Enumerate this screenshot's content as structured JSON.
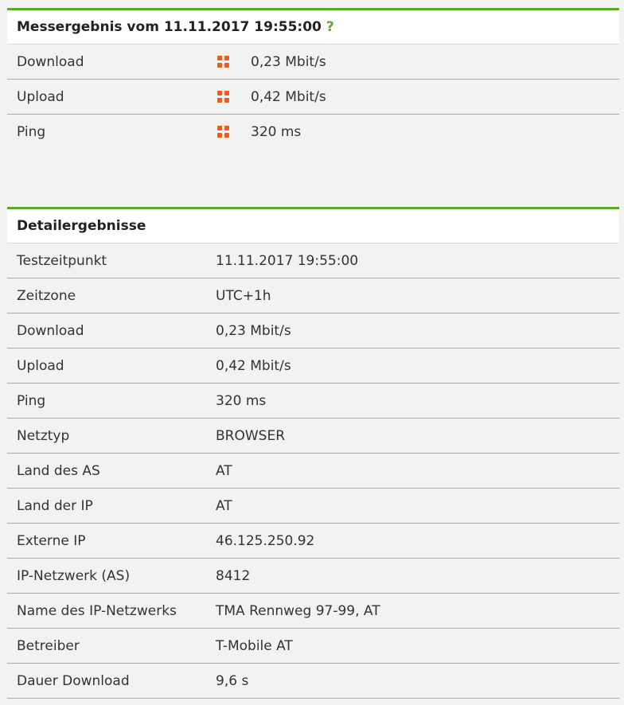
{
  "summary": {
    "title": "Messergebnis vom 11.11.2017 19:55:00",
    "help": "?",
    "rows": [
      {
        "label": "Download",
        "value": "0,23 Mbit/s",
        "quality": "poor"
      },
      {
        "label": "Upload",
        "value": "0,42 Mbit/s",
        "quality": "poor"
      },
      {
        "label": "Ping",
        "value": "320 ms",
        "quality": "poor"
      }
    ]
  },
  "details": {
    "title": "Detailergebnisse",
    "rows": [
      {
        "label": "Testzeitpunkt",
        "value": "11.11.2017 19:55:00"
      },
      {
        "label": "Zeitzone",
        "value": "UTC+1h"
      },
      {
        "label": "Download",
        "value": "0,23 Mbit/s"
      },
      {
        "label": "Upload",
        "value": "0,42 Mbit/s"
      },
      {
        "label": "Ping",
        "value": "320 ms"
      },
      {
        "label": "Netztyp",
        "value": "BROWSER"
      },
      {
        "label": "Land des AS",
        "value": "AT"
      },
      {
        "label": "Land der IP",
        "value": "AT"
      },
      {
        "label": "Externe IP",
        "value": "46.125.250.92"
      },
      {
        "label": "IP-Netzwerk (AS)",
        "value": "8412"
      },
      {
        "label": "Name des IP-Netzwerks",
        "value": "TMA Rennweg 97-99, AT"
      },
      {
        "label": "Betreiber",
        "value": "T-Mobile AT"
      },
      {
        "label": "Dauer Download",
        "value": "9,6 s"
      }
    ]
  },
  "colors": {
    "accent": "#5aaa2a",
    "quality_poor": "#f05a1a"
  },
  "icons": {
    "quality": "quality-grid-icon"
  }
}
